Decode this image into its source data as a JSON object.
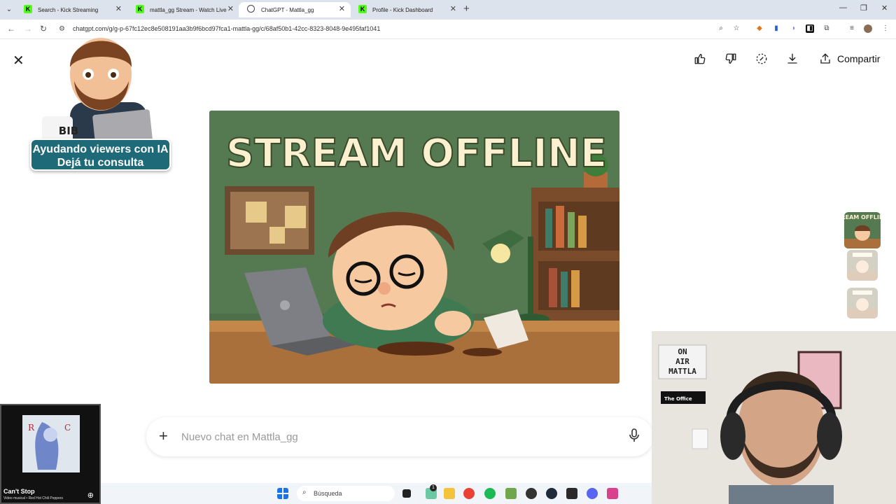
{
  "browser": {
    "tabs": [
      {
        "title": "Search - Kick Streaming",
        "favicon": "K",
        "active": false
      },
      {
        "title": "mattla_gg Stream - Watch Live",
        "favicon": "K",
        "active": false
      },
      {
        "title": "ChatGPT - Mattla_gg",
        "favicon": "",
        "active": true
      },
      {
        "title": "Profile - Kick Dashboard",
        "favicon": "K",
        "active": false
      }
    ],
    "url_visible": "chatgpt.com/g/g-p-67fc12ec8e508191aa3b9f6bcd97fca1-mattla-gg/c/68af50b1-42cc-8323-8048-9e495faf1041"
  },
  "viewer": {
    "share_label": "Compartir",
    "image_headline": "STREAM OFFLINE",
    "thumb_caption": "REAM OFFLIN"
  },
  "composer": {
    "placeholder": "Nuevo chat en Mattla_gg"
  },
  "overlay": {
    "mug_text": "BIB",
    "banner_line1": "Ayudando viewers con IA",
    "banner_line2": "Dejá tu consulta"
  },
  "music": {
    "title": "Can't Stop",
    "subtitle": "Video musical • Red Hot Chili Peppers"
  },
  "webcam": {
    "sign_line1": "ON",
    "sign_line2": "AIR",
    "sign_line3": "MATTLA",
    "sticker": "The Office"
  },
  "taskbar": {
    "search_placeholder": "Búsqueda",
    "notification_count": "1",
    "colors": {
      "kick_green": "#53fc18",
      "accent": "#1e6a78"
    }
  }
}
